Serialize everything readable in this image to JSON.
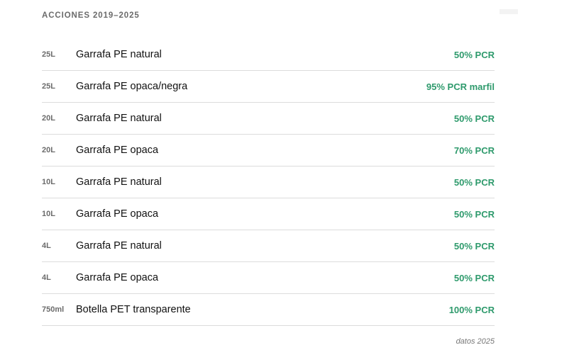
{
  "header": {
    "title": "ACCIONES 2019–2025"
  },
  "rows": [
    {
      "size": "25L",
      "product": "Garrafa PE natural",
      "pcr": "50% PCR"
    },
    {
      "size": "25L",
      "product": "Garrafa PE opaca/negra",
      "pcr": "95% PCR marfil"
    },
    {
      "size": "20L",
      "product": "Garrafa PE natural",
      "pcr": "50% PCR"
    },
    {
      "size": "20L",
      "product": "Garrafa PE opaca",
      "pcr": "70% PCR"
    },
    {
      "size": "10L",
      "product": "Garrafa PE natural",
      "pcr": "50% PCR"
    },
    {
      "size": "10L",
      "product": "Garrafa PE opaca",
      "pcr": "50% PCR"
    },
    {
      "size": "4L",
      "product": "Garrafa PE natural",
      "pcr": "50% PCR"
    },
    {
      "size": "4L",
      "product": "Garrafa PE opaca",
      "pcr": "50% PCR"
    },
    {
      "size": "750ml",
      "product": "Botella PET transparente",
      "pcr": "100% PCR"
    }
  ],
  "footer": {
    "note": "datos 2025"
  },
  "colors": {
    "accent": "#2e9a6c",
    "muted": "#6b6b6b"
  }
}
